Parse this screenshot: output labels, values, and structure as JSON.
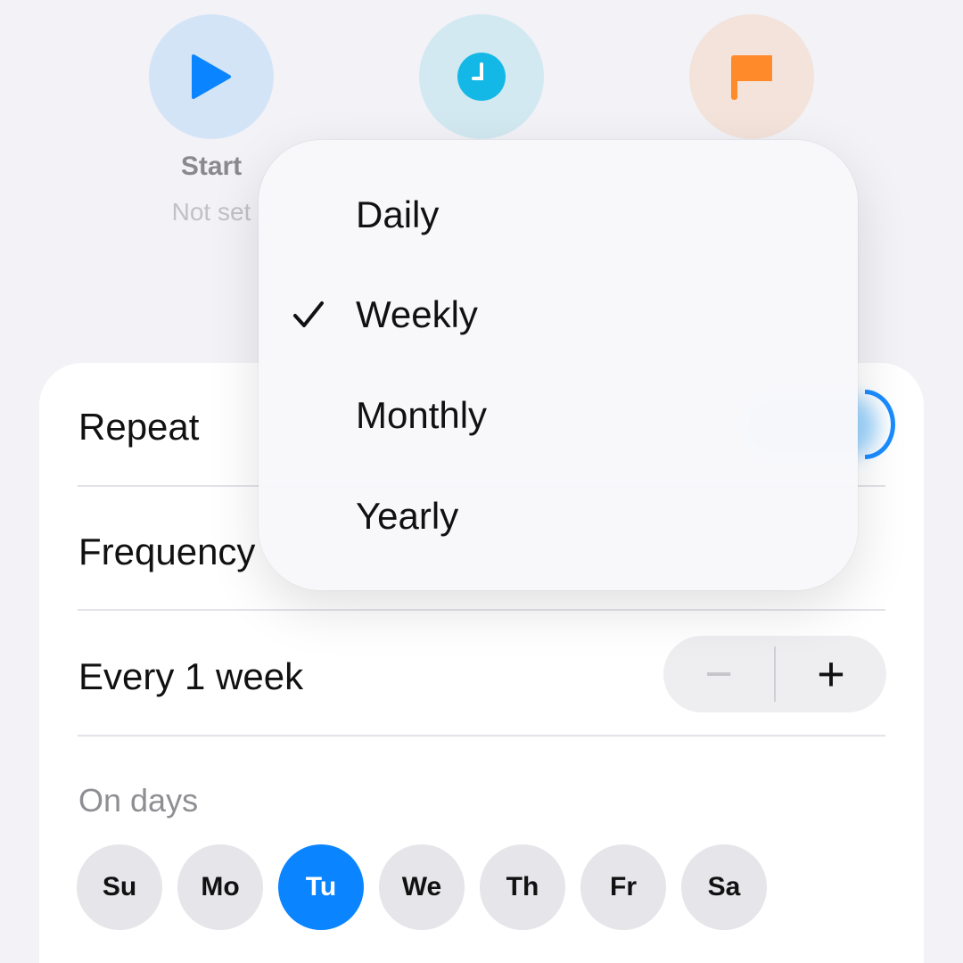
{
  "top_items": {
    "start": {
      "label": "Start",
      "value": "Not set",
      "icon": "play-icon"
    },
    "time": {
      "icon": "clock-icon"
    },
    "end": {
      "icon": "flag-icon"
    }
  },
  "colors": {
    "accent": "#0a84ff",
    "clock": "#14b8e6",
    "flag": "#ff8a2a"
  },
  "card": {
    "repeat_label": "Repeat",
    "frequency_label": "Frequency",
    "interval_label": "Every 1 week",
    "stepper": {
      "minus": "−",
      "plus": "+"
    },
    "days_label": "On days",
    "days": [
      {
        "label": "Su",
        "selected": false
      },
      {
        "label": "Mo",
        "selected": false
      },
      {
        "label": "Tu",
        "selected": true
      },
      {
        "label": "We",
        "selected": false
      },
      {
        "label": "Th",
        "selected": false
      },
      {
        "label": "Fr",
        "selected": false
      },
      {
        "label": "Sa",
        "selected": false
      }
    ]
  },
  "frequency_menu": {
    "items": [
      {
        "label": "Daily",
        "checked": false
      },
      {
        "label": "Weekly",
        "checked": true
      },
      {
        "label": "Monthly",
        "checked": false
      },
      {
        "label": "Yearly",
        "checked": false
      }
    ]
  }
}
